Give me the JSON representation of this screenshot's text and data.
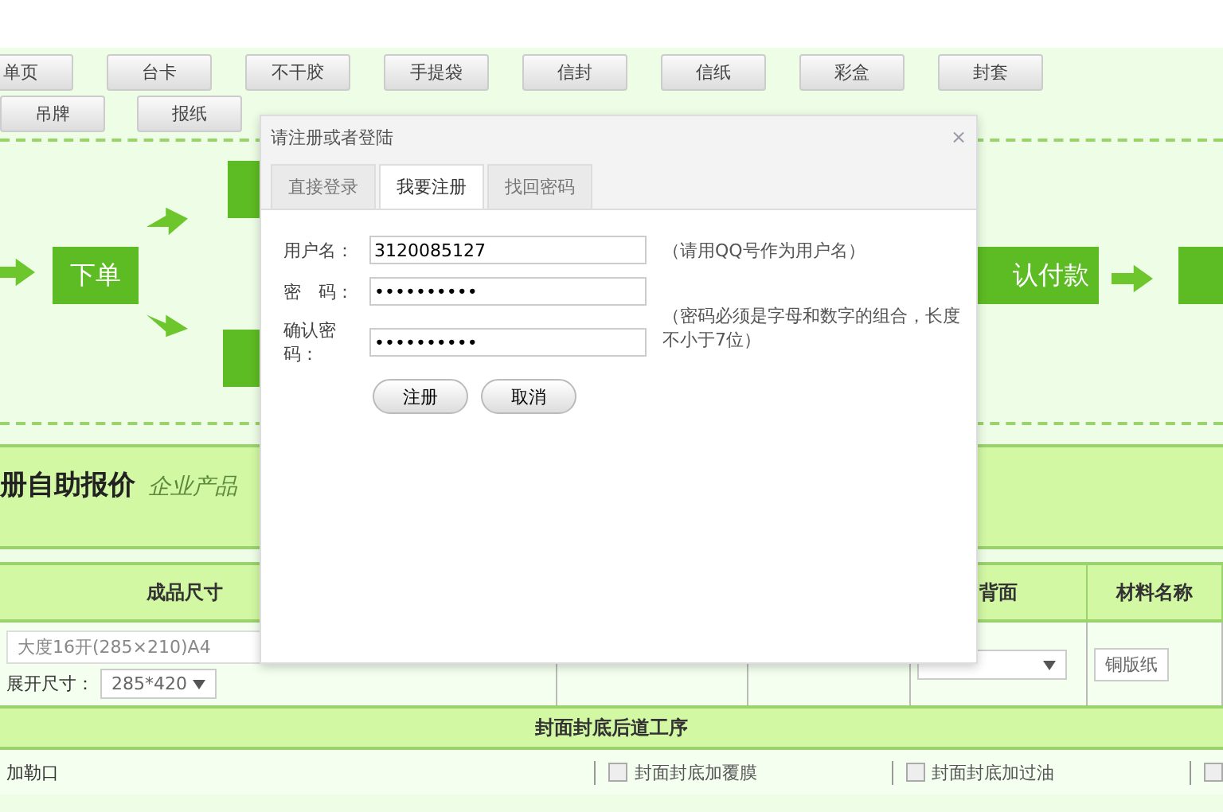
{
  "categories_row1": [
    "单页",
    "台卡",
    "不干胶",
    "手提袋",
    "信封",
    "信纸",
    "彩盒",
    "封套"
  ],
  "categories_row2": [
    "吊牌",
    "报纸"
  ],
  "flow": {
    "steps": [
      "下单",
      "认付款"
    ]
  },
  "quote": {
    "title": "册自助报价",
    "subtitle": "企业产品"
  },
  "table": {
    "columns": [
      "成品尺寸",
      "背面",
      "材料名称"
    ],
    "size_value": "大度16开(285×210)A4",
    "unfold_label": "展开尺寸：",
    "unfold_value": "285*420",
    "material_value": "铜版纸",
    "section": "封面封底后道工序",
    "row_label": "加勒口",
    "options": [
      {
        "label": "封面封底加覆膜",
        "checked": false
      },
      {
        "label": "封面封底加过油",
        "checked": false
      },
      {
        "checked": false
      }
    ]
  },
  "dialog": {
    "title": "请注册或者登陆",
    "close": "×",
    "tabs": [
      {
        "label": "直接登录",
        "selected": false
      },
      {
        "label": "我要注册",
        "selected": true
      },
      {
        "label": "找回密码",
        "selected": false
      }
    ],
    "username": {
      "label": "用户名：",
      "value": "3120085127",
      "hint": "（请用QQ号作为用户名）"
    },
    "password": {
      "label": "密　码：",
      "value": "••••••••••"
    },
    "confirm": {
      "label": "确认密码：",
      "value": "••••••••••"
    },
    "password_hint": "（密码必须是字母和数字的组合，长度不小于7位）",
    "buttons": [
      "注册",
      "取消"
    ]
  }
}
